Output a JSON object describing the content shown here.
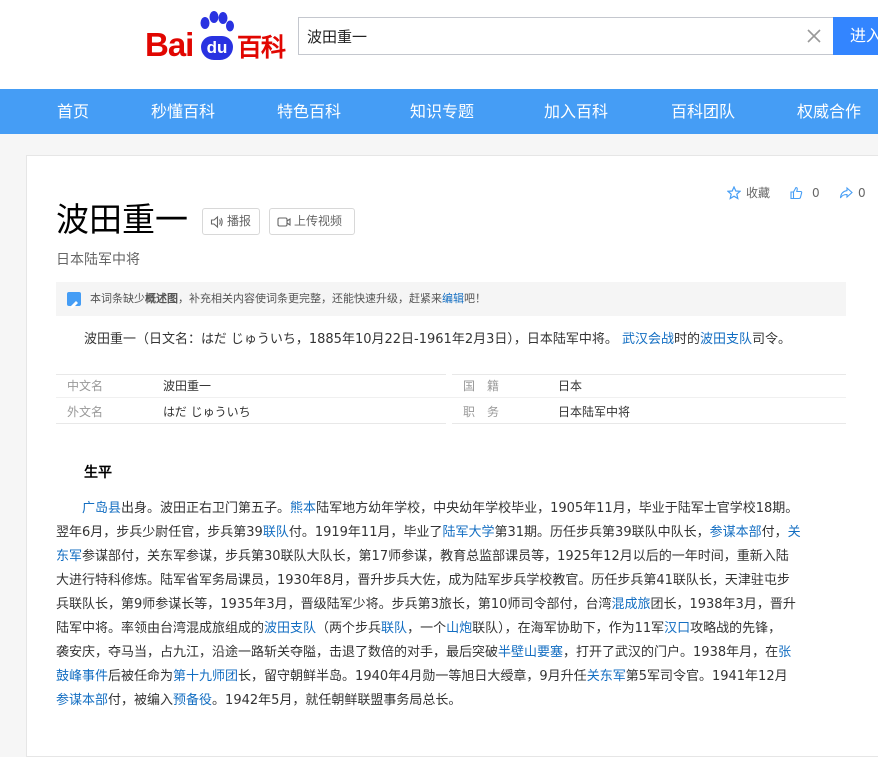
{
  "header": {
    "logo": {
      "bai": "Bai",
      "du": "du",
      "baike": "百科"
    },
    "search": {
      "value": "波田重一"
    },
    "enter_button": "进入"
  },
  "nav": {
    "items": [
      "首页",
      "秒懂百科",
      "特色百科",
      "知识专题",
      "加入百科",
      "百科团队",
      "权威合作"
    ]
  },
  "entry": {
    "title": "波田重一",
    "subtitle": "日本陆军中将",
    "broadcast_button": "播报",
    "upload_video_button": "上传视频",
    "tools": {
      "collect": "收藏",
      "likes": "0",
      "shares": "0"
    },
    "notice": {
      "pre": "本词条缺少",
      "bold": "概述图",
      "mid": "，补充相关内容使词条更完整，还能快速升级，赶紧来",
      "link": "编辑",
      "post": "吧！"
    },
    "summary": {
      "pre": "波田重一（日文名：はだ じゅういち，1885年10月22日-1961年2月3日），日本陆军中将。",
      "link1": "武汉会战",
      "mid": "时的",
      "link2": "波田支队",
      "post": "司令。"
    },
    "info": {
      "chinese_name_key": "中文名",
      "chinese_name_val": "波田重一",
      "foreign_name_key": "外文名",
      "foreign_name_val": "はだ じゅういち",
      "nationality_key": "国　籍",
      "nationality_val": "日本",
      "position_key": "职　务",
      "position_val": "日本陆军中将"
    },
    "section_title": "生平",
    "biography": {
      "l1": [
        "广岛县",
        "出身。波田正右卫门第五子。",
        "熊本",
        "陆军地方幼年学校，中央幼年学校毕业，1905年11月，毕业于陆军士官学校18期。"
      ],
      "l2": [
        "翌年6月，步兵少尉任官，步兵第39",
        "联队",
        "付。1919年11月，毕业了",
        "陆军大学",
        "第31期。历任步兵第39联队中队长，",
        "参谋本部",
        "付，",
        "关"
      ],
      "l3": [
        "东军",
        "参谋部付，关东军参谋，步兵第30联队大队长，第17师参谋，教育总监部课员等，1925年12月以后的一年时间，重新入陆"
      ],
      "l4": [
        "大进行特科修炼。陆军省军务局课员，1930年8月，晋升步兵大佐，成为陆军步兵学校教官。历任步兵第41联队长，天津驻屯步"
      ],
      "l5": [
        "兵联队长，第9师参谋长等，1935年3月，晋级陆军少将。步兵第3旅长，第10师司令部付，台湾",
        "混成旅",
        "团长，1938年3月，晋升"
      ],
      "l6": [
        "陆军中将。率领由台湾混成旅组成的",
        "波田支队",
        "（两个步兵",
        "联队",
        "，一个",
        "山炮",
        "联队），在海军协助下，作为11军",
        "汉口",
        "攻略战的先锋，"
      ],
      "l7": [
        "袭安庆，夺马当，占九江，沿途一路斩关夺隘，击退了数倍的对手，最后突破",
        "半壁山要塞",
        "，打开了武汉的门户。1938年月，在",
        "张"
      ],
      "l8": [
        "鼓峰事件",
        "后被任命为",
        "第十九师团",
        "长，留守朝鲜半岛。1940年4月勋一等旭日大绶章，9月升任",
        "关东军",
        "第5军司令官。1941年12月"
      ],
      "l9": [
        "参谋本部",
        "付，被编入",
        "预备役",
        "。1942年5月，就任朝鲜联盟事务局总长。"
      ]
    }
  },
  "colors": {
    "nav_bg": "#459df5",
    "search_button": "#3385ff",
    "brand_red": "#e10601",
    "brand_blue": "#2932e1",
    "link": "#136ec2"
  }
}
